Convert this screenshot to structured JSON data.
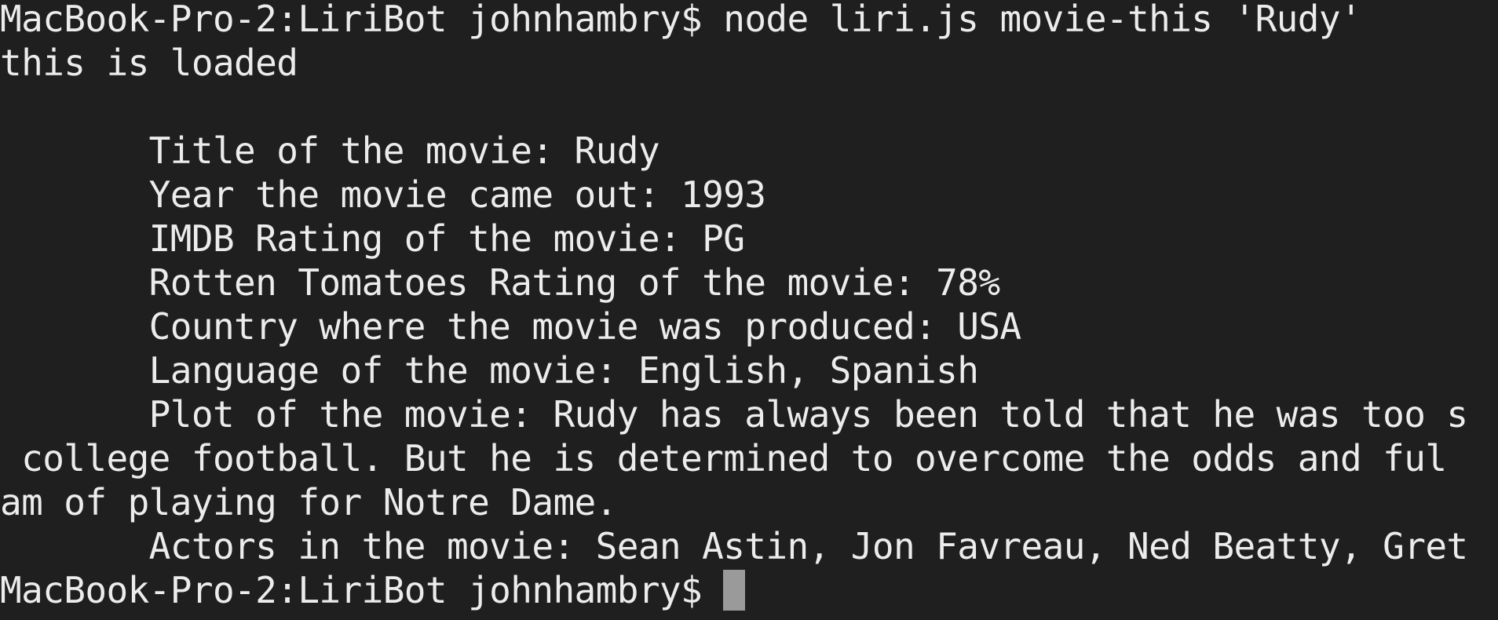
{
  "terminal": {
    "command_line": {
      "prompt": "MacBook-Pro-2:LiriBot johnhambry$ ",
      "command": "node liri.js movie-this 'Rudy'"
    },
    "output": {
      "loaded": "this is loaded",
      "blank": "",
      "title": "       Title of the movie: Rudy",
      "year": "       Year the movie came out: 1993",
      "imdb": "       IMDB Rating of the movie: PG",
      "rotten": "       Rotten Tomatoes Rating of the movie: 78%",
      "country": "       Country where the movie was produced: USA",
      "language": "       Language of the movie: English, Spanish",
      "plot_1": "       Plot of the movie: Rudy has always been told that he was too s",
      "plot_2": " college football. But he is determined to overcome the odds and ful",
      "plot_3": "am of playing for Notre Dame.",
      "actors": "       Actors in the movie: Sean Astin, Jon Favreau, Ned Beatty, Gret"
    },
    "final_prompt": "MacBook-Pro-2:LiriBot johnhambry$ "
  }
}
